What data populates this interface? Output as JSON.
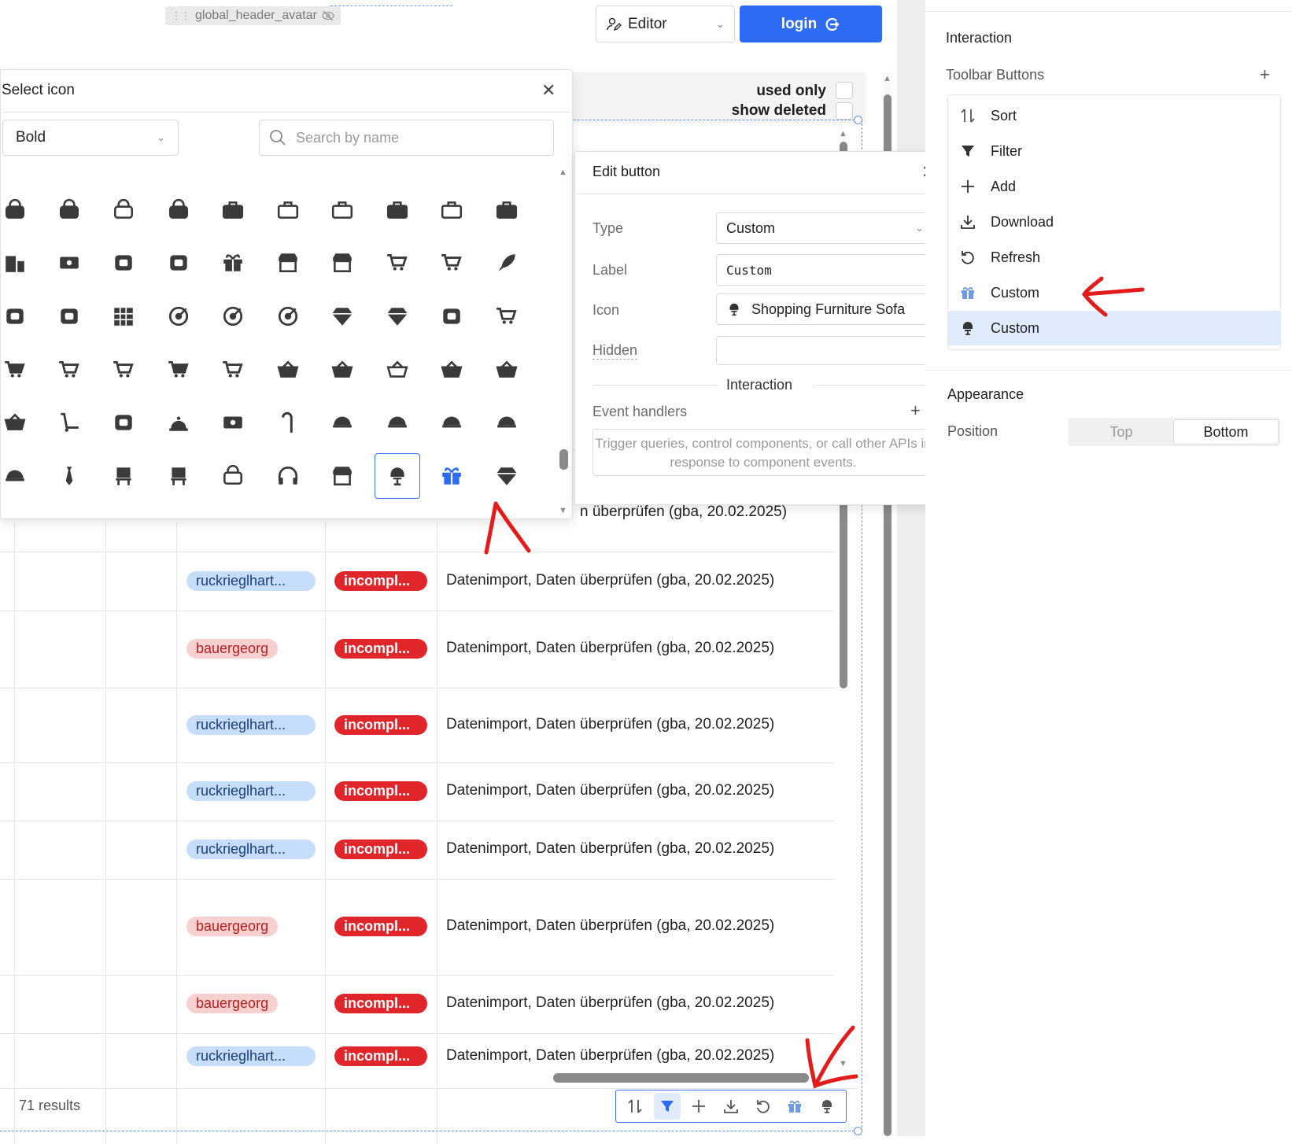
{
  "header": {
    "component_chip": "global_header_avatar",
    "editor_select": "Editor",
    "login_button": "login"
  },
  "table": {
    "used_only": "used only",
    "show_deleted": "show deleted",
    "partial_row_text": "n überprüfen (gba, 20.02.2025)",
    "rows": [
      {
        "user": "ruckrieglhart...",
        "user_style": "blue",
        "status": "incompl...",
        "comment": "Datenimport, Daten überprüfen (gba, 20.02.2025)"
      },
      {
        "user": "bauergeorg",
        "user_style": "pink",
        "status": "incompl...",
        "comment": "Datenimport, Daten überprüfen (gba, 20.02.2025)"
      },
      {
        "user": "ruckrieglhart...",
        "user_style": "blue",
        "status": "incompl...",
        "comment": "Datenimport, Daten überprüfen (gba, 20.02.2025)"
      },
      {
        "user": "ruckrieglhart...",
        "user_style": "blue",
        "status": "incompl...",
        "comment": "Datenimport, Daten überprüfen (gba, 20.02.2025)"
      },
      {
        "user": "ruckrieglhart...",
        "user_style": "blue",
        "status": "incompl...",
        "comment": "Datenimport, Daten überprüfen (gba, 20.02.2025)"
      },
      {
        "user": "bauergeorg",
        "user_style": "pink",
        "status": "incompl...",
        "comment": "Datenimport, Daten überprüfen (gba, 20.02.2025)"
      },
      {
        "user": "bauergeorg",
        "user_style": "pink",
        "status": "incompl...",
        "comment": "Datenimport, Daten überprüfen (gba, 20.02.2025)"
      },
      {
        "user": "ruckrieglhart...",
        "user_style": "blue",
        "status": "incompl...",
        "comment": "Datenimport, Daten überprüfen (gba, 20.02.2025)"
      }
    ],
    "results": "71 results",
    "toolbar_icons": [
      "sort-icon",
      "filter-icon",
      "add-icon",
      "download-icon",
      "refresh-icon",
      "gift-icon",
      "sofa-icon"
    ],
    "toolbar_active": "filter-icon"
  },
  "icon_panel": {
    "title": "Select icon",
    "weight": "Bold",
    "search_placeholder": "Search by name",
    "rows": [
      [
        "lock-bag-icon",
        "lock-bag-filled-icon",
        "bag-icon",
        "bag-filled-icon",
        "briefcase-filled-icon",
        "briefcase-icon",
        "suitcase-outline-icon",
        "suitcase-filled-icon",
        "toolbox-icon",
        "toolbox-filled-icon"
      ],
      [
        "buildings-icon",
        "id-card-icon",
        "handshake-icon",
        "plant-heart-icon",
        "gift-heart-icon",
        "store-settings-icon",
        "store-filled-icon",
        "cart-arrow-icon",
        "cart-moving-icon",
        "rocket-icon"
      ],
      [
        "scale-dollar-icon",
        "growth-icon",
        "calendar-grid-icon",
        "target-check-icon",
        "target-x-icon",
        "target-icon",
        "diamond-gear-icon",
        "diamond-settings-icon",
        "burst-icon",
        "shopping-cart-icon"
      ],
      [
        "cart-filled-icon",
        "cart-outline-icon",
        "cart-empty-icon",
        "cart-items-icon",
        "cart-plus-icon",
        "basket-grid-icon",
        "basket-filled-icon",
        "basket-outline-icon",
        "basket-half-icon",
        "basket-icon"
      ],
      [
        "basket-bold-icon",
        "hand-truck-icon",
        "apron-icon",
        "service-bell-icon",
        "money-bow-icon",
        "cane-icon",
        "cap-icon",
        "helmet-icon",
        "cook-icon",
        "helmet-side-icon"
      ],
      [
        "cap-side-icon",
        "tie-icon",
        "podium-icon",
        "director-chair-icon",
        "locker-icon",
        "headphones-icon",
        "storefront-icon",
        "sofa-icon",
        "gift-icon",
        "diamond-icon"
      ]
    ],
    "selected_icon": "sofa-icon",
    "highlight_icon": "gift-icon"
  },
  "edit_panel": {
    "title": "Edit button",
    "type_label": "Type",
    "type_value": "Custom",
    "label_label": "Label",
    "label_value": "Custom",
    "icon_label": "Icon",
    "icon_value": "Shopping Furniture Sofa",
    "hidden_label": "Hidden",
    "hidden_value": "",
    "interaction_section": "Interaction",
    "event_handlers_label": "Event handlers",
    "event_placeholder": "Trigger queries, control components, or call other APIs in response to component events."
  },
  "inspector": {
    "section_interaction": "Interaction",
    "toolbar_buttons_label": "Toolbar Buttons",
    "toolbar_buttons": [
      {
        "label": "Sort",
        "icon": "sort-icon"
      },
      {
        "label": "Filter",
        "icon": "filter-icon"
      },
      {
        "label": "Add",
        "icon": "add-icon"
      },
      {
        "label": "Download",
        "icon": "download-icon"
      },
      {
        "label": "Refresh",
        "icon": "refresh-icon"
      },
      {
        "label": "Custom",
        "icon": "gift-icon"
      },
      {
        "label": "Custom",
        "icon": "sofa-icon"
      }
    ],
    "selected_index": 6,
    "section_appearance": "Appearance",
    "position_label": "Position",
    "position_options": [
      "Top",
      "Bottom"
    ],
    "position_selected": "Bottom"
  },
  "colors": {
    "accent": "#2d6bf5",
    "status_red": "#e0262b",
    "badge_blue_bg": "#c6ddfb",
    "badge_pink_bg": "#f8d0d0",
    "annotation_red": "#e41b1b",
    "icon_gray": "#3a3a3a"
  }
}
